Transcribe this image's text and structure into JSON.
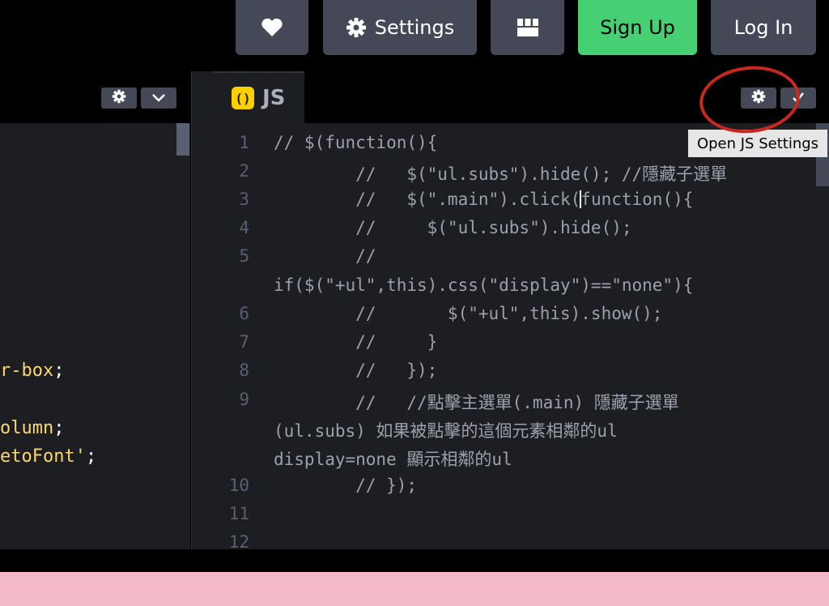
{
  "topbar": {
    "heart_icon": "heart-icon",
    "settings_label": "Settings",
    "settings_icon": "gear-icon",
    "layout_icon": "layout-grid-icon",
    "signup_label": "Sign Up",
    "login_label": "Log In",
    "colors": {
      "button": "#444857",
      "signup": "#47cf73"
    }
  },
  "left_pane": {
    "gear_icon": "gear-icon",
    "collapse_icon": "chevron-down-icon",
    "lines": [
      {
        "text": "r-box",
        "punct": ";"
      },
      {
        "text": "olumn",
        "punct": ";"
      },
      {
        "text": "etoFont'",
        "punct": ";"
      }
    ]
  },
  "js_pane": {
    "badge": "()",
    "tab_label": "JS",
    "gear_icon": "gear-icon",
    "check_icon": "check-icon",
    "tooltip": "Open JS Settings",
    "line_numbers": [
      "1",
      "2",
      "3",
      "4",
      "5",
      "6",
      "7",
      "8",
      "9",
      "10",
      "11",
      "12"
    ],
    "code": [
      "// $(function(){",
      "        //   $(\"ul.subs\").hide(); //隱藏子選單",
      "        //   $(\".main\").click(",
      "function(){",
      "        //     $(\"ul.subs\").hide();",
      "        //",
      "if($(\"+ul\",this).css(\"display\")==\"none\"){",
      "        //       $(\"+ul\",this).show();",
      "        //     }",
      "        //   }",
      ");",
      "        //   //點擊主選單(.main) 隱藏子選單",
      "(ul.subs) 如果被點擊的這個元素相鄰的ul",
      "display=none 顯示相鄰的ul",
      "        // });"
    ]
  },
  "annotation_color": "#c8281e",
  "footer_color": "#f4b9c9"
}
